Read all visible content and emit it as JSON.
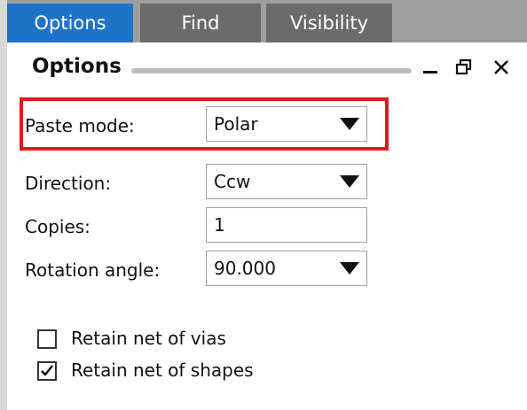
{
  "tabs": [
    {
      "label": "Options",
      "active": true
    },
    {
      "label": "Find",
      "active": false
    },
    {
      "label": "Visibility",
      "active": false
    }
  ],
  "panel": {
    "title": "Options",
    "controls": {
      "minimize_icon": "minimize-icon",
      "float_icon": "float-icon",
      "close_icon": "close-icon"
    }
  },
  "fields": {
    "paste_mode": {
      "label": "Paste mode:",
      "value": "Polar"
    },
    "direction": {
      "label": "Direction:",
      "value": "Ccw"
    },
    "copies": {
      "label": "Copies:",
      "value": "1"
    },
    "rotation_angle": {
      "label": "Rotation angle:",
      "value": "90.000"
    }
  },
  "checkboxes": [
    {
      "label": "Retain net of vias",
      "checked": false
    },
    {
      "label": "Retain net of shapes",
      "checked": true
    }
  ],
  "colors": {
    "active_tab": "#1e73c8",
    "inactive_tab": "#6b6b6b",
    "tabbar_bg": "#9e9e9e",
    "highlight": "#e01b1b"
  }
}
